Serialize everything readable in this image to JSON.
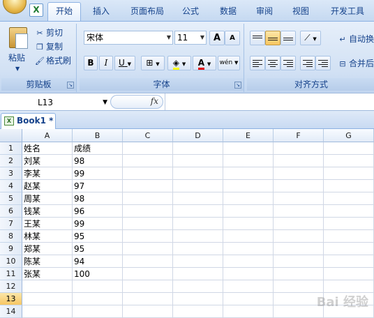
{
  "app": {
    "icon_letter": "X"
  },
  "tabs": [
    "开始",
    "插入",
    "页面布局",
    "公式",
    "数据",
    "审阅",
    "视图",
    "开发工具"
  ],
  "clipboard": {
    "paste": "粘贴",
    "cut": "剪切",
    "copy": "复制",
    "format_painter": "格式刷",
    "label": "剪贴板"
  },
  "font": {
    "name": "宋体",
    "size": "11",
    "grow": "A",
    "shrink": "A",
    "bold": "B",
    "italic": "I",
    "underline": "U",
    "phonetic": "wén",
    "label": "字体"
  },
  "alignment": {
    "wrap_text": "自动换",
    "merge": "合并后",
    "label": "对齐方式"
  },
  "formula_bar": {
    "name_box": "L13",
    "fx": "fx",
    "content": ""
  },
  "workbook": {
    "title": "Book1 *"
  },
  "columns": [
    "A",
    "B",
    "C",
    "D",
    "E",
    "F",
    "G"
  ],
  "rows": [
    {
      "n": "1",
      "a": "姓名",
      "b": "成绩"
    },
    {
      "n": "2",
      "a": "刘某",
      "b": "98"
    },
    {
      "n": "3",
      "a": "李某",
      "b": "99"
    },
    {
      "n": "4",
      "a": "赵某",
      "b": "97"
    },
    {
      "n": "5",
      "a": "周某",
      "b": "98"
    },
    {
      "n": "6",
      "a": "钱某",
      "b": "96"
    },
    {
      "n": "7",
      "a": "王某",
      "b": "99"
    },
    {
      "n": "8",
      "a": "林某",
      "b": "95"
    },
    {
      "n": "9",
      "a": "郑某",
      "b": "95"
    },
    {
      "n": "10",
      "a": "陈某",
      "b": "94"
    },
    {
      "n": "11",
      "a": "张某",
      "b": "100"
    },
    {
      "n": "12",
      "a": "",
      "b": ""
    },
    {
      "n": "13",
      "a": "",
      "b": ""
    },
    {
      "n": "14",
      "a": "",
      "b": ""
    }
  ],
  "active_row": "13",
  "colors": {
    "accent": "#15428b",
    "highlight": "#f7c663"
  },
  "watermark": "Bai 经验"
}
